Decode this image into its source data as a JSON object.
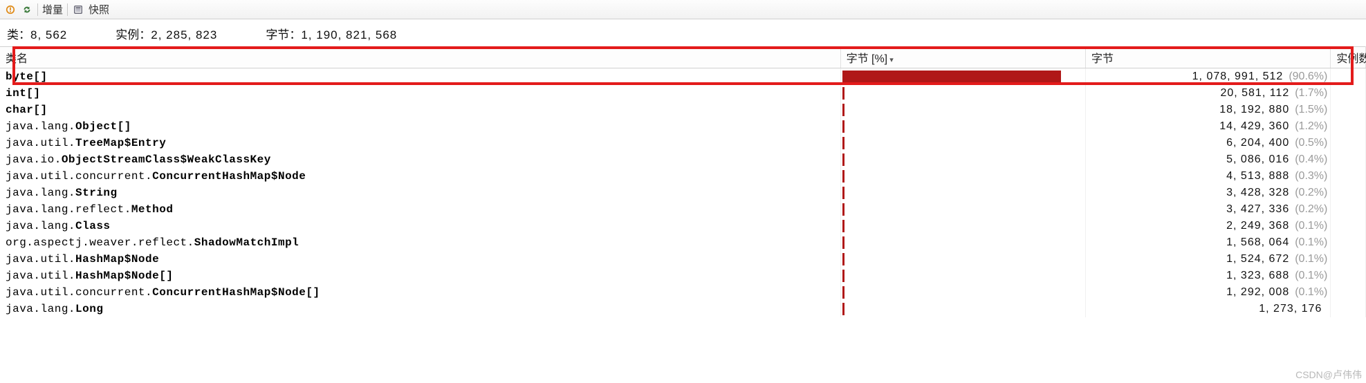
{
  "toolbar": {
    "incremental_label": "增量",
    "snapshot_label": "快照"
  },
  "summary": {
    "classes_label": "类：",
    "classes_value": "8, 562",
    "instances_label": "实例：",
    "instances_value": "2, 285, 823",
    "bytes_label": "字节：",
    "bytes_value": "1, 190, 821, 568"
  },
  "columns": {
    "name": "类名",
    "pct": "字节 [%]",
    "bytes": "字节",
    "instances": "实例数"
  },
  "rows": [
    {
      "name": [
        [
          "",
          "byte[]"
        ]
      ],
      "bytes": "1, 078, 991, 512",
      "pct": "(90.6%)",
      "bar": 90.6
    },
    {
      "name": [
        [
          "",
          "int[]"
        ]
      ],
      "bytes": "20, 581, 112",
      "pct": "(1.7%)",
      "bar": 1.7
    },
    {
      "name": [
        [
          "",
          "char[]"
        ]
      ],
      "bytes": "18, 192, 880",
      "pct": "(1.5%)",
      "bar": 1.5
    },
    {
      "name": [
        [
          "java.lang.",
          "Object[]"
        ]
      ],
      "bytes": "14, 429, 360",
      "pct": "(1.2%)",
      "bar": 1.2
    },
    {
      "name": [
        [
          "java.util.",
          "TreeMap$Entry"
        ]
      ],
      "bytes": "6, 204, 400",
      "pct": "(0.5%)",
      "bar": 0.5
    },
    {
      "name": [
        [
          "java.io.",
          "ObjectStreamClass$WeakClassKey"
        ]
      ],
      "bytes": "5, 086, 016",
      "pct": "(0.4%)",
      "bar": 0.4
    },
    {
      "name": [
        [
          "java.util.concurrent.",
          "ConcurrentHashMap$Node"
        ]
      ],
      "bytes": "4, 513, 888",
      "pct": "(0.3%)",
      "bar": 0.3
    },
    {
      "name": [
        [
          "java.lang.",
          "String"
        ]
      ],
      "bytes": "3, 428, 328",
      "pct": "(0.2%)",
      "bar": 0.2
    },
    {
      "name": [
        [
          "java.lang.reflect.",
          "Method"
        ]
      ],
      "bytes": "3, 427, 336",
      "pct": "(0.2%)",
      "bar": 0.2
    },
    {
      "name": [
        [
          "java.lang.",
          "Class"
        ]
      ],
      "bytes": "2, 249, 368",
      "pct": "(0.1%)",
      "bar": 0.1
    },
    {
      "name": [
        [
          "org.aspectj.weaver.reflect.",
          "ShadowMatchImpl"
        ]
      ],
      "bytes": "1, 568, 064",
      "pct": "(0.1%)",
      "bar": 0.1
    },
    {
      "name": [
        [
          "java.util.",
          "HashMap$Node"
        ]
      ],
      "bytes": "1, 524, 672",
      "pct": "(0.1%)",
      "bar": 0.1
    },
    {
      "name": [
        [
          "java.util.",
          "HashMap$Node[]"
        ]
      ],
      "bytes": "1, 323, 688",
      "pct": "(0.1%)",
      "bar": 0.1
    },
    {
      "name": [
        [
          "java.util.concurrent.",
          "ConcurrentHashMap$Node[]"
        ]
      ],
      "bytes": "1, 292, 008",
      "pct": "(0.1%)",
      "bar": 0.1
    },
    {
      "name": [
        [
          "java.lang.",
          "Long"
        ]
      ],
      "bytes": "1, 273, 176",
      "pct": "",
      "bar": 0.1
    }
  ],
  "watermark": "CSDN@卢伟伟"
}
